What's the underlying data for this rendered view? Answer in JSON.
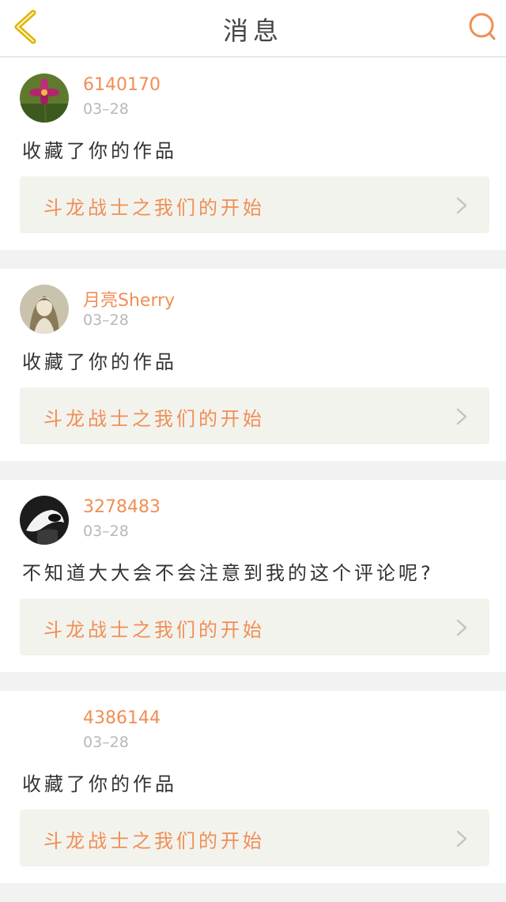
{
  "header": {
    "title": "消息"
  },
  "messages": [
    {
      "username": "6140170",
      "date": "03–28",
      "action": "收藏了你的作品",
      "work_title": "斗龙战士之我们的开始"
    },
    {
      "username": "月亮Sherry",
      "date": "03–28",
      "action": "收藏了你的作品",
      "work_title": "斗龙战士之我们的开始"
    },
    {
      "username": "3278483",
      "date": "03–28",
      "action": "不知道大大会不会注意到我的这个评论呢?",
      "work_title": "斗龙战士之我们的开始"
    },
    {
      "username": "4386144",
      "date": "03–28",
      "action": "收藏了你的作品",
      "work_title": "斗龙战士之我们的开始"
    }
  ],
  "colors": {
    "accent": "#f08e55",
    "back_icon": "#e0b400"
  }
}
